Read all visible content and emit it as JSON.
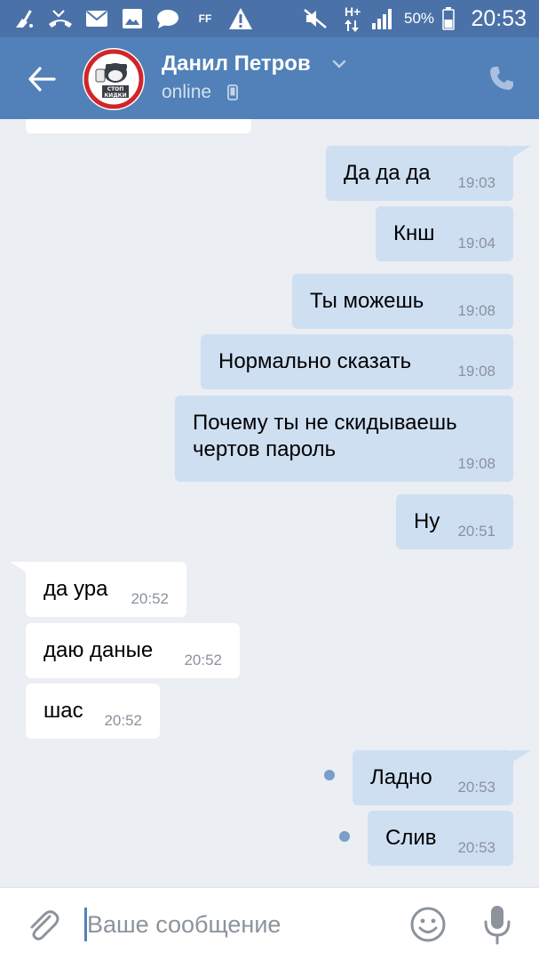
{
  "status_bar": {
    "battery_percent": "50%",
    "time": "20:53",
    "network": "H+",
    "icons": [
      "cleaner-icon",
      "missed-call-icon",
      "mail-icon",
      "gallery-icon",
      "chat-icon",
      "ff-icon",
      "warning-icon",
      "mute-icon",
      "signal-icon",
      "battery-icon"
    ],
    "ff_label": "FF"
  },
  "header": {
    "contact_name": "Данил Петров",
    "status": "online",
    "avatar_lines": [
      "СТОП",
      "КИДКИ"
    ],
    "colors": {
      "header_bg": "#5181b8",
      "status_bg": "#4a72a8"
    }
  },
  "messages": [
    {
      "direction": "out",
      "text": "Да да да",
      "time": "19:03"
    },
    {
      "direction": "out",
      "text": "Кнш",
      "time": "19:04"
    },
    {
      "direction": "out",
      "text": "Ты можешь",
      "time": "19:08"
    },
    {
      "direction": "out",
      "text": "Нормально сказать",
      "time": "19:08"
    },
    {
      "direction": "out",
      "text": "Почему ты не скидываешь\nчертов пароль",
      "time": "19:08"
    },
    {
      "direction": "out",
      "text": "Ну",
      "time": "20:51"
    },
    {
      "direction": "in",
      "text": "да ура",
      "time": "20:52"
    },
    {
      "direction": "in",
      "text": "даю даные",
      "time": "20:52"
    },
    {
      "direction": "in",
      "text": "шас",
      "time": "20:52"
    },
    {
      "direction": "out",
      "text": "Ладно",
      "time": "20:53",
      "unread": true
    },
    {
      "direction": "out",
      "text": "Слив",
      "time": "20:53",
      "unread": true
    }
  ],
  "composer": {
    "placeholder": "Ваше сообщение",
    "value": ""
  },
  "colors": {
    "outgoing_bubble": "#cfdff2",
    "incoming_bubble": "#ffffff",
    "background": "#ebeef2",
    "unread_dot": "#7b9ec8"
  }
}
